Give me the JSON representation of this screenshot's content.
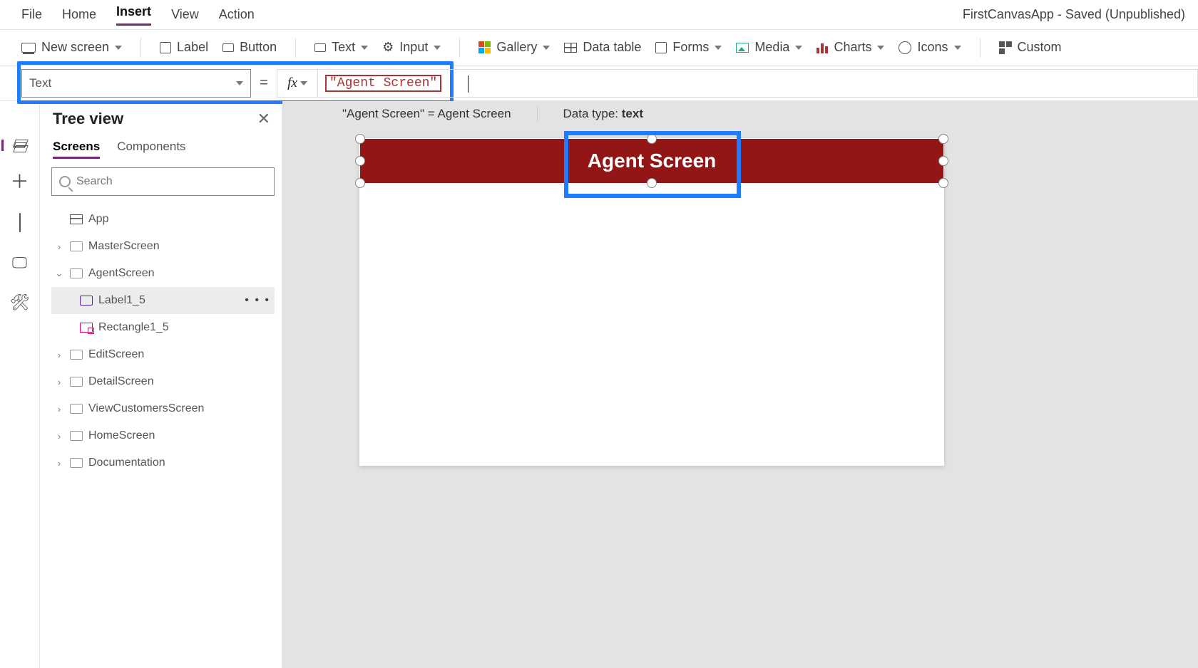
{
  "app_title": "FirstCanvasApp - Saved (Unpublished)",
  "menu": {
    "file": "File",
    "home": "Home",
    "insert": "Insert",
    "view": "View",
    "action": "Action",
    "active": "insert"
  },
  "ribbon": {
    "new_screen": "New screen",
    "label": "Label",
    "button": "Button",
    "text": "Text",
    "input": "Input",
    "gallery": "Gallery",
    "data_table": "Data table",
    "forms": "Forms",
    "media": "Media",
    "charts": "Charts",
    "icons": "Icons",
    "custom": "Custom"
  },
  "formula": {
    "property": "Text",
    "fx": "fx",
    "value": "\"Agent Screen\""
  },
  "info": {
    "eval": "\"Agent Screen\"  =  Agent Screen",
    "datatype_label": "Data type: ",
    "datatype_value": "text"
  },
  "tree": {
    "title": "Tree view",
    "tabs": {
      "screens": "Screens",
      "components": "Components"
    },
    "search_placeholder": "Search",
    "app": "App",
    "items": [
      {
        "label": "MasterScreen",
        "expanded": false
      },
      {
        "label": "AgentScreen",
        "expanded": true
      },
      {
        "label": "EditScreen",
        "expanded": false
      },
      {
        "label": "DetailScreen",
        "expanded": false
      },
      {
        "label": "ViewCustomersScreen",
        "expanded": false
      },
      {
        "label": "HomeScreen",
        "expanded": false
      },
      {
        "label": "Documentation",
        "expanded": false
      }
    ],
    "agent_children": {
      "label1": "Label1_5",
      "rect1": "Rectangle1_5"
    }
  },
  "canvas": {
    "label_text": "Agent Screen"
  }
}
